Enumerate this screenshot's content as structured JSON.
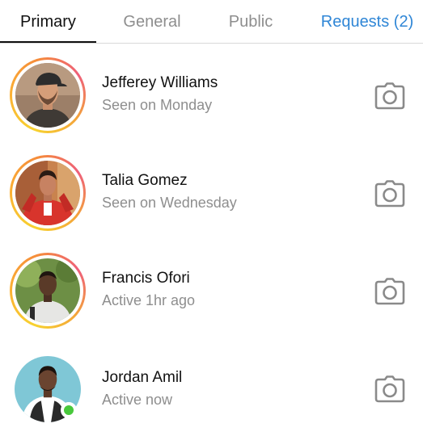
{
  "tabs": [
    {
      "label": "Primary"
    },
    {
      "label": "General"
    },
    {
      "label": "Public"
    },
    {
      "label": "Requests (2)"
    }
  ],
  "colors": {
    "accent": "#2f86d6",
    "online": "#48c83b",
    "muted_text": "#8e8e8e"
  },
  "conversations": [
    {
      "name": "Jefferey Williams",
      "status": "Seen on Monday",
      "story_ring": true,
      "online": false,
      "action_icon": "camera-icon"
    },
    {
      "name": "Talia Gomez",
      "status": "Seen on Wednesday",
      "story_ring": true,
      "online": false,
      "action_icon": "camera-icon"
    },
    {
      "name": "Francis Ofori",
      "status": "Active 1hr ago",
      "story_ring": true,
      "online": false,
      "action_icon": "camera-icon"
    },
    {
      "name": "Jordan Amil",
      "status": "Active now",
      "story_ring": false,
      "online": true,
      "action_icon": "camera-icon"
    }
  ]
}
